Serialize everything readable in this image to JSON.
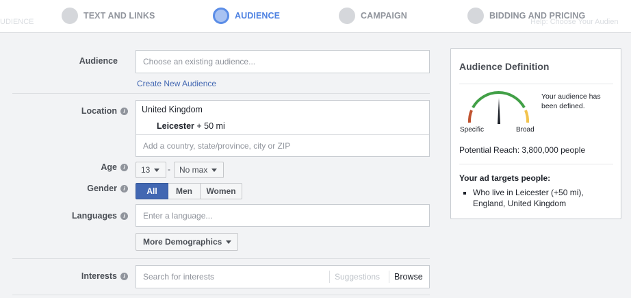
{
  "wizard": {
    "ghost_left": "UDIENCE",
    "ghost_right": "Help: Choose Your Audien",
    "steps": [
      {
        "label": "TEXT AND LINKS"
      },
      {
        "label": "AUDIENCE"
      },
      {
        "label": "CAMPAIGN"
      },
      {
        "label": "BIDDING AND PRICING"
      }
    ]
  },
  "audience": {
    "label": "Audience",
    "placeholder": "Choose an existing audience...",
    "create_link": "Create New Audience"
  },
  "location": {
    "label": "Location",
    "country": "United Kingdom",
    "city": "Leicester",
    "radius": "+ 50 mi",
    "placeholder": "Add a country, state/province, city or ZIP"
  },
  "age": {
    "label": "Age",
    "min": "13",
    "separator": "-",
    "max": "No max"
  },
  "gender": {
    "label": "Gender",
    "options": [
      "All",
      "Men",
      "Women"
    ]
  },
  "languages": {
    "label": "Languages",
    "placeholder": "Enter a language..."
  },
  "more_demographics": "More Demographics",
  "interests": {
    "label": "Interests",
    "placeholder": "Search for interests",
    "suggestions": "Suggestions",
    "browse": "Browse"
  },
  "definition": {
    "title": "Audience Definition",
    "status": "Your audience has been defined.",
    "specific": "Specific",
    "broad": "Broad",
    "reach": "Potential Reach: 3,800,000 people",
    "targets_heading": "Your ad targets people:",
    "targets": [
      "Who live in Leicester (+50 mi), England, United Kingdom"
    ]
  },
  "colors": {
    "accent": "#4267b2",
    "gauge_green": "#42a047",
    "gauge_red": "#c0532f",
    "gauge_yellow": "#f2c34d"
  }
}
